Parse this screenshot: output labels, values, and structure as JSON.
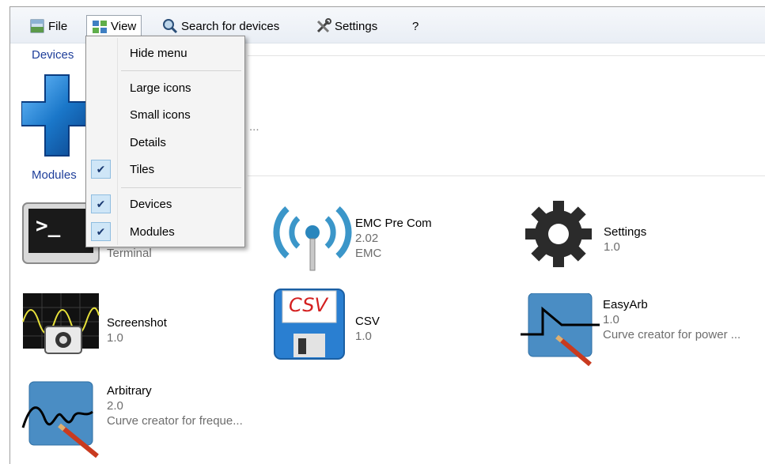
{
  "menubar": {
    "items": [
      {
        "label": "File",
        "icon": "file-icon"
      },
      {
        "label": "View",
        "icon": "view-icon"
      },
      {
        "label": "Search for devices",
        "icon": "search-icon"
      },
      {
        "label": "Settings",
        "icon": "settings-tools-icon"
      },
      {
        "label": "?",
        "icon": ""
      }
    ]
  },
  "groups": {
    "devices": "Devices",
    "modules": "Modules",
    "devices_ellipsis": "..."
  },
  "view_menu": {
    "items": [
      {
        "label": "Hide menu",
        "checked": false
      },
      {
        "label": "Large icons",
        "checked": false
      },
      {
        "label": "Small icons",
        "checked": false
      },
      {
        "label": "Details",
        "checked": false
      },
      {
        "label": "Tiles",
        "checked": true
      },
      {
        "label": "Devices",
        "checked": true
      },
      {
        "label": "Modules",
        "checked": true
      }
    ],
    "check_glyph": "✔"
  },
  "modules": [
    {
      "name": "",
      "version": "",
      "desc": "Terminal",
      "icon": "terminal-icon"
    },
    {
      "name": "EMC Pre Com",
      "version": "2.02",
      "desc": "EMC",
      "icon": "antenna-icon"
    },
    {
      "name": "Settings",
      "version": "1.0",
      "desc": "",
      "icon": "gear-icon"
    },
    {
      "name": "Screenshot",
      "version": "1.0",
      "desc": "",
      "icon": "oscilloscope-camera-icon"
    },
    {
      "name": "CSV",
      "version": "1.0",
      "desc": "",
      "icon": "csv-floppy-icon"
    },
    {
      "name": "EasyArb",
      "version": "1.0",
      "desc": "Curve creator for power ...",
      "icon": "easyarb-curve-icon"
    },
    {
      "name": "Arbitrary",
      "version": "2.0",
      "desc": "Curve creator for freque...",
      "icon": "arbitrary-curve-icon"
    }
  ],
  "csv_icon_text": "CSV",
  "terminal_prompt": ">_",
  "colors": {
    "group_header": "#1e3e9a",
    "check_bg": "#cfe6f7",
    "accent_blue": "#1a77c9"
  }
}
